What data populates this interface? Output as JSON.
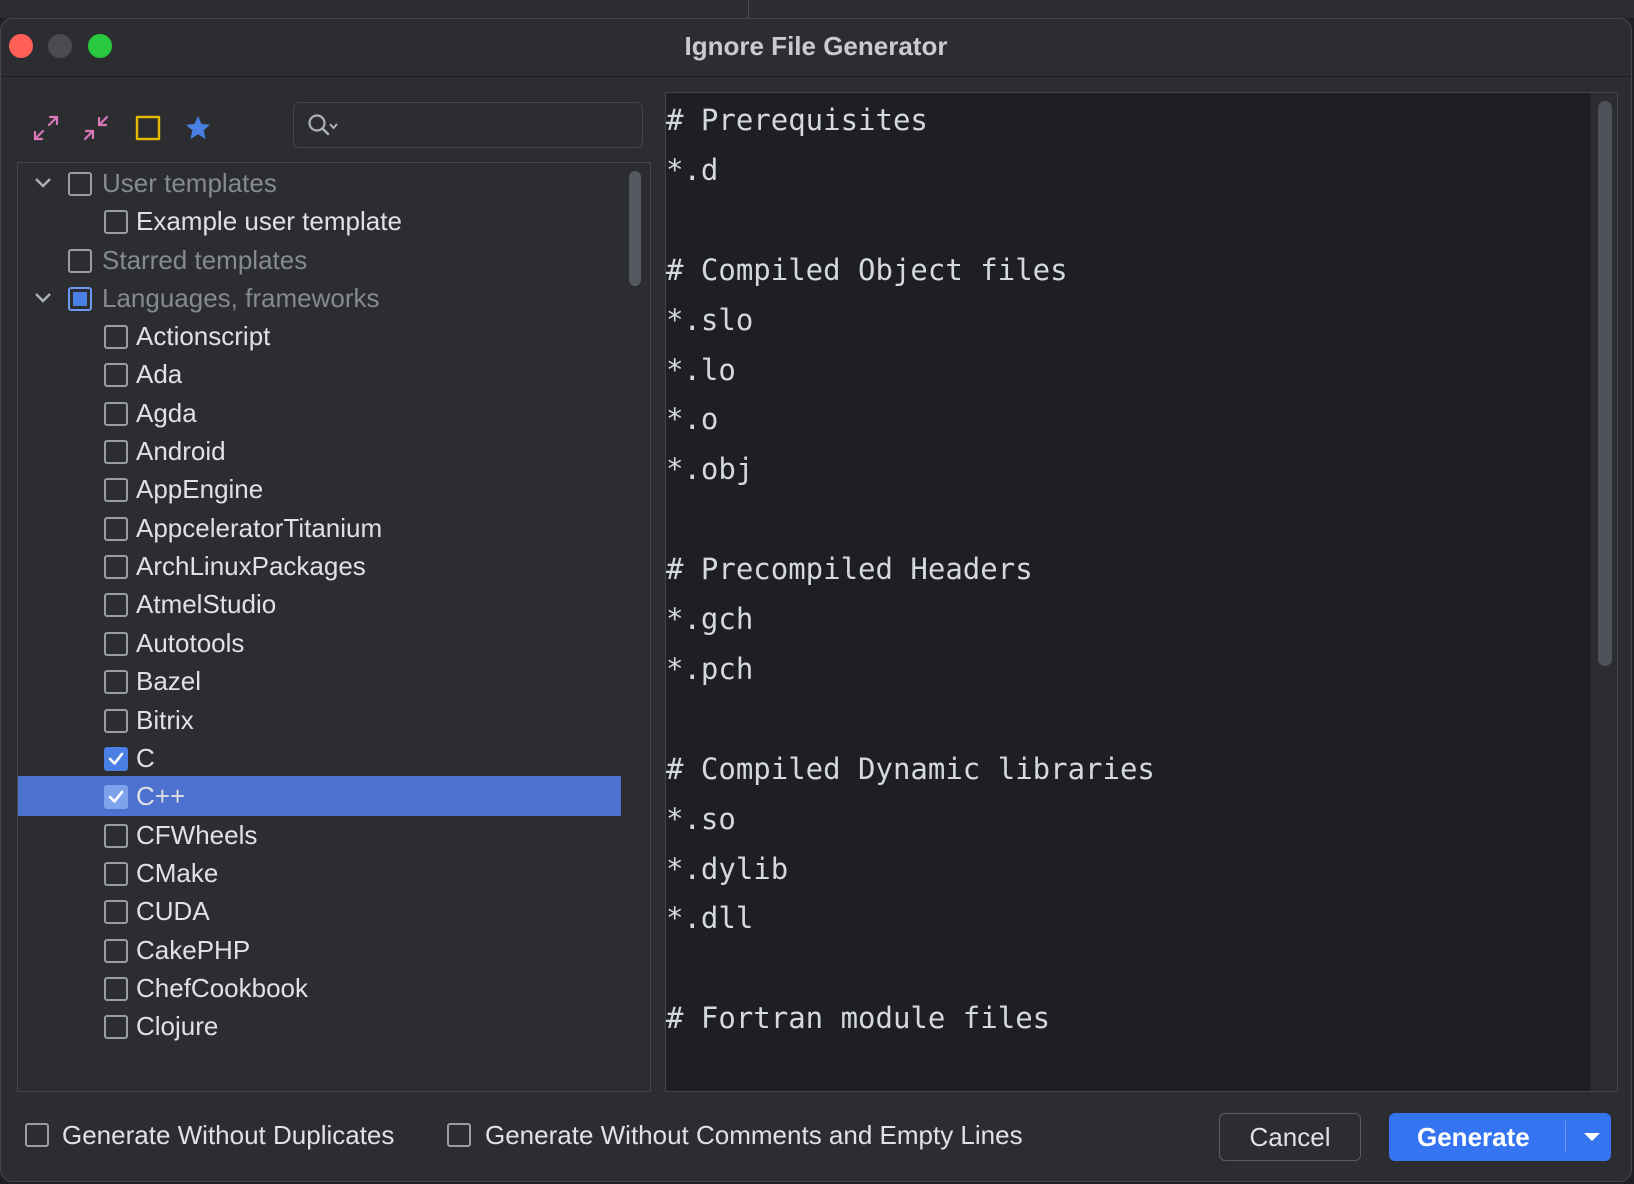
{
  "window": {
    "title": "Ignore File Generator"
  },
  "toolbar": {
    "icons": [
      "expand-all-icon",
      "collapse-all-icon",
      "select-box-icon",
      "star-icon"
    ]
  },
  "search": {
    "placeholder": ""
  },
  "tree": {
    "user_templates": {
      "label": "User templates",
      "state": "unchecked",
      "expanded": true
    },
    "example_user_template": {
      "label": "Example user template",
      "state": "unchecked"
    },
    "starred_templates": {
      "label": "Starred templates",
      "state": "unchecked"
    },
    "languages": {
      "label": "Languages, frameworks",
      "state": "partial",
      "expanded": true
    },
    "items": [
      {
        "label": "Actionscript",
        "checked": false,
        "selected": false
      },
      {
        "label": "Ada",
        "checked": false,
        "selected": false
      },
      {
        "label": "Agda",
        "checked": false,
        "selected": false
      },
      {
        "label": "Android",
        "checked": false,
        "selected": false
      },
      {
        "label": "AppEngine",
        "checked": false,
        "selected": false
      },
      {
        "label": "AppceleratorTitanium",
        "checked": false,
        "selected": false
      },
      {
        "label": "ArchLinuxPackages",
        "checked": false,
        "selected": false
      },
      {
        "label": "AtmelStudio",
        "checked": false,
        "selected": false
      },
      {
        "label": "Autotools",
        "checked": false,
        "selected": false
      },
      {
        "label": "Bazel",
        "checked": false,
        "selected": false
      },
      {
        "label": "Bitrix",
        "checked": false,
        "selected": false
      },
      {
        "label": "C",
        "checked": true,
        "selected": false
      },
      {
        "label": "C++",
        "checked": true,
        "selected": true
      },
      {
        "label": "CFWheels",
        "checked": false,
        "selected": false
      },
      {
        "label": "CMake",
        "checked": false,
        "selected": false
      },
      {
        "label": "CUDA",
        "checked": false,
        "selected": false
      },
      {
        "label": "CakePHP",
        "checked": false,
        "selected": false
      },
      {
        "label": "ChefCookbook",
        "checked": false,
        "selected": false
      },
      {
        "label": "Clojure",
        "checked": false,
        "selected": false
      }
    ]
  },
  "preview": {
    "lines": [
      "# Prerequisites",
      "*.d",
      "",
      "# Compiled Object files",
      "*.slo",
      "*.lo",
      "*.o",
      "*.obj",
      "",
      "# Precompiled Headers",
      "*.gch",
      "*.pch",
      "",
      "# Compiled Dynamic libraries",
      "*.so",
      "*.dylib",
      "*.dll",
      "",
      "# Fortran module files"
    ]
  },
  "options": {
    "without_duplicates": {
      "label": "Generate Without Duplicates",
      "checked": false
    },
    "without_comments": {
      "label": "Generate Without Comments and Empty Lines",
      "checked": false
    }
  },
  "buttons": {
    "cancel": "Cancel",
    "generate": "Generate"
  },
  "colors": {
    "accent": "#3574f0",
    "selection": "#4c71cf",
    "star": "#4a7fe3",
    "select_box": "#e6b800"
  }
}
